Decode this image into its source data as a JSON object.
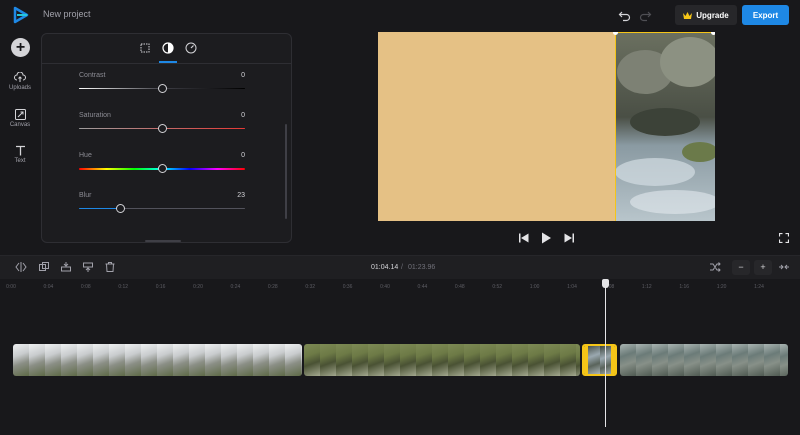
{
  "app": {
    "project_title": "New project",
    "upgrade_label": "Upgrade",
    "export_label": "Export",
    "colors": {
      "accent": "#1e88e5",
      "selection": "#f5c518",
      "background": "#18181b"
    }
  },
  "sidebar": {
    "add_icon": "plus-icon",
    "items": [
      {
        "label": "Uploads",
        "icon": "cloud-upload-icon"
      },
      {
        "label": "Canvas",
        "icon": "canvas-resize-icon"
      },
      {
        "label": "Text",
        "icon": "text-icon"
      }
    ]
  },
  "panel": {
    "tabs": [
      {
        "icon": "crop-icon",
        "active": false
      },
      {
        "icon": "adjust-contrast-icon",
        "active": true
      },
      {
        "icon": "speed-gauge-icon",
        "active": false
      }
    ],
    "adjustments": [
      {
        "name": "Contrast",
        "value": "0",
        "level": 0.5
      },
      {
        "name": "Saturation",
        "value": "0",
        "level": 0.5
      },
      {
        "name": "Hue",
        "value": "0",
        "level": 0.5
      },
      {
        "name": "Blur",
        "value": "23",
        "level": 0.25
      }
    ]
  },
  "player": {
    "controls": [
      "skip-back-icon",
      "play-icon",
      "skip-forward-icon"
    ],
    "fullscreen_icon": "fullscreen-icon"
  },
  "timeline": {
    "current_time": "01:04.14",
    "separator": "/",
    "total_time": "01:23.96",
    "zoom_out_label": "−",
    "zoom_in_label": "+",
    "ruler_labels": [
      "0:00",
      "0:04",
      "0:08",
      "0:12",
      "0:16",
      "0:20",
      "0:24",
      "0:28",
      "0:32",
      "0:36",
      "0:40",
      "0:44",
      "0:48",
      "0:52",
      "1:00",
      "1:04",
      "1:08",
      "1:12",
      "1:16",
      "1:20",
      "1:24"
    ],
    "clips": [
      {
        "name": "clip-1",
        "selected": false,
        "theme": "mountain"
      },
      {
        "name": "clip-2",
        "selected": false,
        "theme": "forest"
      },
      {
        "name": "clip-3",
        "selected": true,
        "theme": "water"
      },
      {
        "name": "clip-4",
        "selected": false,
        "theme": "rocks"
      }
    ]
  }
}
